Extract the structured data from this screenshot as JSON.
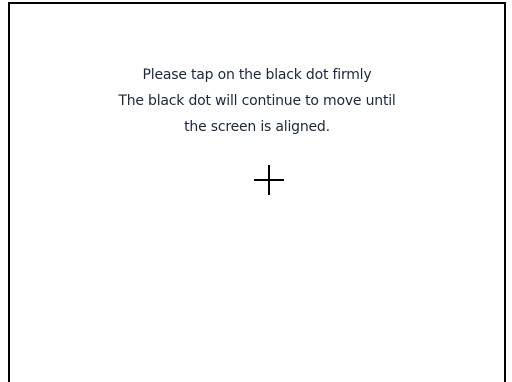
{
  "calibration": {
    "instructions": [
      "Please tap on the black dot firmly",
      "The black dot will continue to move until",
      "the screen is aligned."
    ],
    "target_icon": "crosshair-icon"
  }
}
